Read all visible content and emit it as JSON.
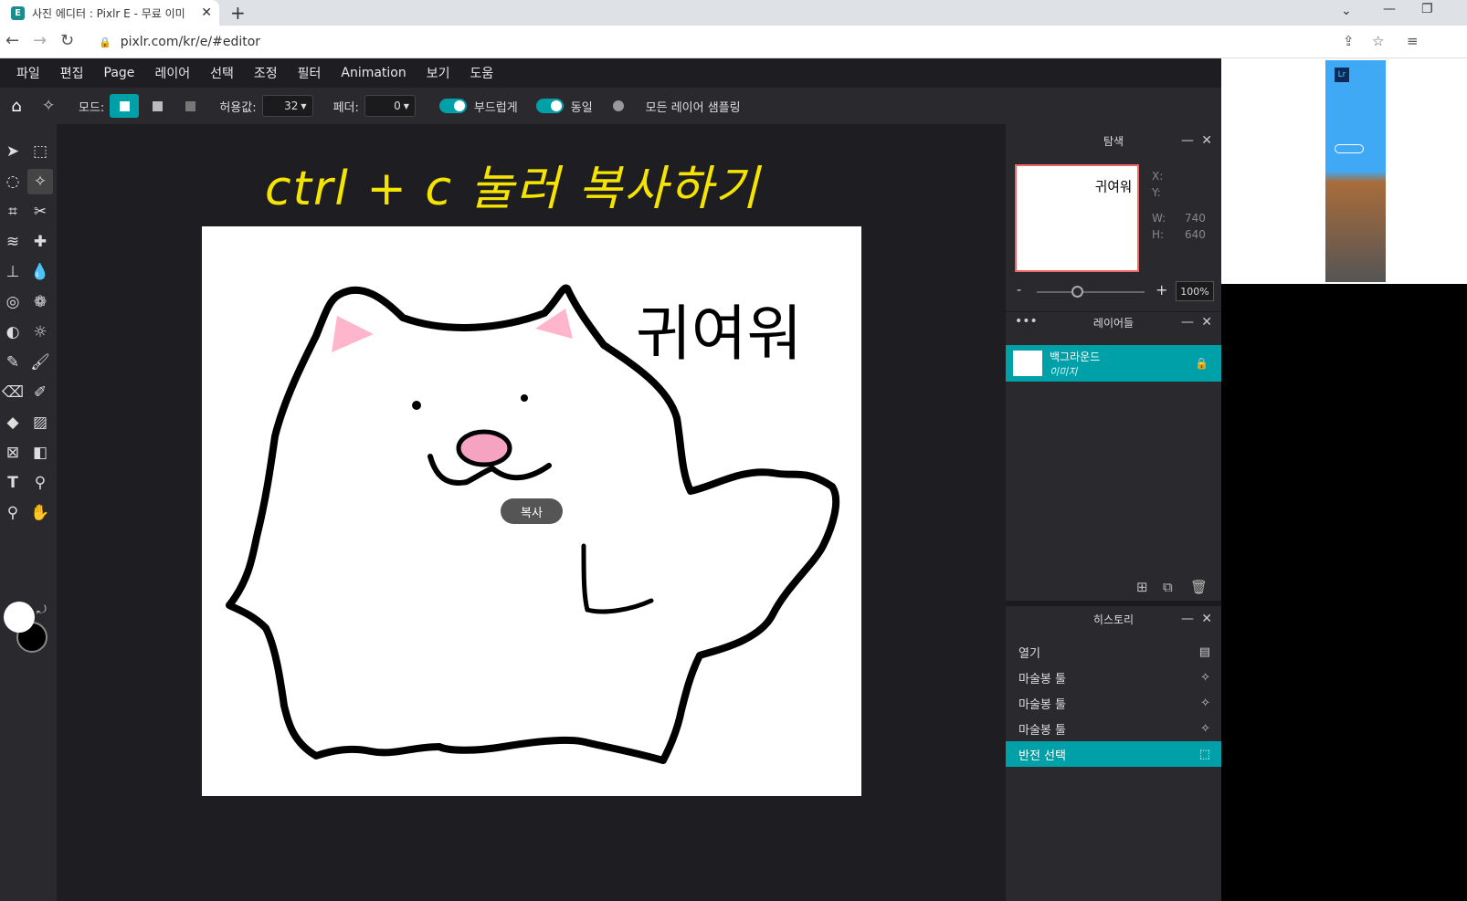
{
  "browser": {
    "tab_title": "사진 에디터 : Pixlr E - 무료 이미",
    "url": "pixlr.com/kr/e/#editor"
  },
  "menu": [
    "파일",
    "편집",
    "Page",
    "레이어",
    "선택",
    "조정",
    "필터",
    "Animation",
    "보기",
    "도움"
  ],
  "options": {
    "mode_label": "모드:",
    "tolerance_label": "허용값:",
    "tolerance_value": "32",
    "feather_label": "페더:",
    "feather_value": "0",
    "smooth_label": "부드럽게",
    "contiguous_label": "동일",
    "sample_all_label": "모든 레이어 샘플링"
  },
  "canvas": {
    "heading": "ctrl + c 눌러 복사하기",
    "handwriting": "귀여워",
    "copy_popup": "복사"
  },
  "navigator": {
    "title": "탐색",
    "x_label": "X:",
    "y_label": "Y:",
    "w_label": "W:",
    "w_value": "740",
    "h_label": "H:",
    "h_value": "640",
    "zoom_minus": "-",
    "zoom_plus": "+",
    "zoom_value": "100%",
    "thumb_text": "귀여워"
  },
  "layers": {
    "title": "레이어들",
    "items": [
      {
        "name": "백그라운드",
        "type": "이미지"
      }
    ]
  },
  "history": {
    "title": "히스토리",
    "items": [
      {
        "label": "열기"
      },
      {
        "label": "마술봉 툴"
      },
      {
        "label": "마술봉 툴"
      },
      {
        "label": "마술봉 툴"
      },
      {
        "label": "반전 선택"
      }
    ]
  },
  "colors": {
    "accent": "#00a0a8",
    "heading": "#f5e400",
    "foreground": "#ffffff",
    "background": "#000000"
  }
}
